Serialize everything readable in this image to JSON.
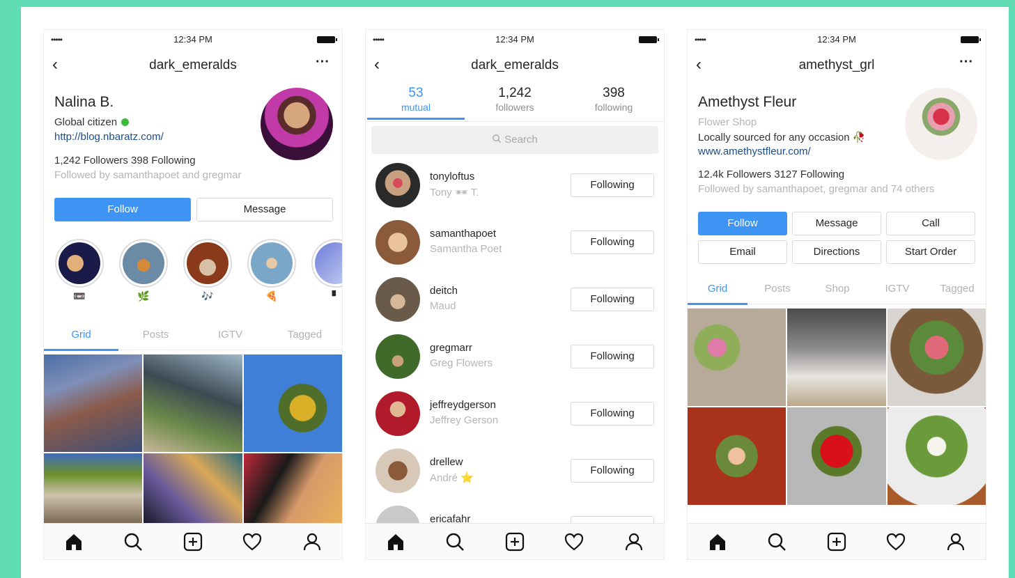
{
  "status": {
    "signal": "•••••",
    "time": "12:34 PM"
  },
  "phone1": {
    "username": "dark_emeralds",
    "name": "Nalina B.",
    "bio": "Global citizen",
    "url": "http://blog.nbaratz.com/",
    "counts": "1,242 Followers  398 Following",
    "followed_by": "Followed by samanthapoet and gregmar",
    "follow_label": "Follow",
    "message_label": "Message",
    "highlights": [
      "📼",
      "🌿",
      "🎶",
      "🍕",
      "▘"
    ],
    "tabs": [
      "Grid",
      "Posts",
      "IGTV",
      "Tagged"
    ]
  },
  "phone2": {
    "username": "dark_emeralds",
    "counts": [
      {
        "num": "53",
        "label": "mutual"
      },
      {
        "num": "1,242",
        "label": "followers"
      },
      {
        "num": "398",
        "label": "following"
      }
    ],
    "search_placeholder": "Search",
    "following_label": "Following",
    "rows": [
      {
        "user": "tonyloftus",
        "name": "Tony 🕶 T."
      },
      {
        "user": "samanthapoet",
        "name": "Samantha Poet"
      },
      {
        "user": "deitch",
        "name": "Maud"
      },
      {
        "user": "gregmarr",
        "name": "Greg Flowers"
      },
      {
        "user": "jeffreydgerson",
        "name": "Jeffrey Gerson"
      },
      {
        "user": "drellew",
        "name": "André ⭐"
      },
      {
        "user": "ericafahr",
        "name": ""
      }
    ]
  },
  "phone3": {
    "username": "amethyst_grl",
    "name": "Amethyst Fleur",
    "category": "Flower Shop",
    "bio": "Locally sourced for any occasion 🥀",
    "url": "www.amethystfleur.com/",
    "counts": "12.4k Followers  3127 Following",
    "followed_by": "Followed by samanthapoet, gregmar and 74 others",
    "buttons": [
      "Follow",
      "Message",
      "Call",
      "Email",
      "Directions",
      "Start Order"
    ],
    "tabs": [
      "Grid",
      "Posts",
      "Shop",
      "IGTV",
      "Tagged"
    ]
  },
  "colors": {
    "accent": "#3d94f2",
    "background": "#5fdcb3"
  },
  "icons": [
    "home-icon",
    "search-icon",
    "add-post-icon",
    "heart-icon",
    "profile-icon",
    "back-icon",
    "more-icon"
  ]
}
